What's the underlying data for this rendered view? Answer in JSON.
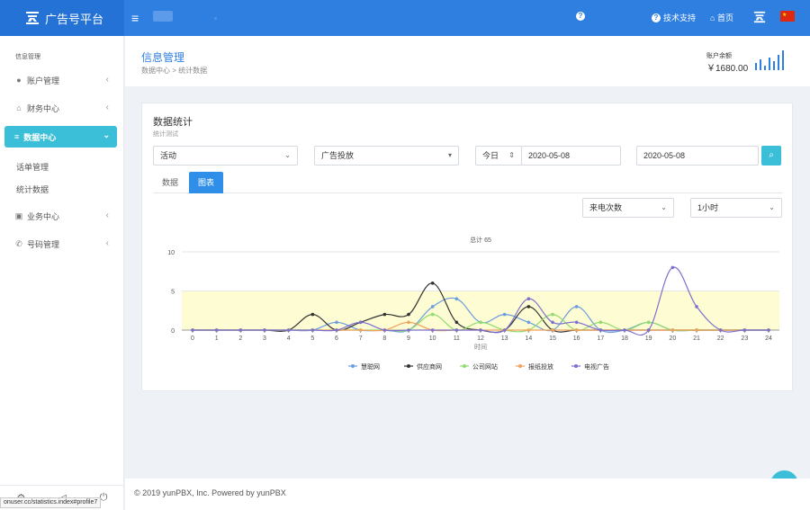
{
  "topbar": {
    "brand": "广告号平台",
    "support": "技术支持",
    "home": "首页"
  },
  "sidebar": {
    "section": "信息管理",
    "items": [
      {
        "label": "账户管理",
        "icon": "user-icon"
      },
      {
        "label": "财务中心",
        "icon": "bank-icon"
      },
      {
        "label": "数据中心",
        "icon": "database-icon"
      },
      {
        "label": "业务中心",
        "icon": "copy-icon"
      },
      {
        "label": "号码管理",
        "icon": "phone-icon"
      }
    ],
    "sub_items": [
      "话单管理",
      "统计数据"
    ]
  },
  "status_url": "onuser.cc/statistics.index#profile7",
  "header": {
    "title": "信息管理",
    "crumb_1": "数据中心",
    "crumb_sep": ">",
    "crumb_2": "统计数据",
    "balance_label": "账户余额",
    "balance_value": "￥1680.00"
  },
  "card": {
    "title": "数据统计",
    "subtitle": "统计测试",
    "filters": {
      "activity": "活动",
      "channel": "广告投放",
      "period": "今日",
      "start_date": "2020-05-08",
      "end_date": "2020-05-08",
      "metric": "来电次数",
      "granularity": "1小时"
    },
    "tabs": [
      "数据",
      "图表"
    ],
    "active_tab": 1
  },
  "footer": {
    "copyright": "© 2019 yunPBX, Inc. Powered by yunPBX"
  },
  "colors": {
    "primary": "#2f7fe0",
    "accent": "#3bbfd8"
  },
  "chart_data": {
    "type": "line",
    "title": "总计 65",
    "xlabel": "时间",
    "x": [
      0,
      1,
      2,
      3,
      4,
      5,
      6,
      7,
      8,
      9,
      10,
      11,
      12,
      13,
      14,
      15,
      16,
      17,
      18,
      19,
      20,
      21,
      22,
      23,
      24
    ],
    "ylim": [
      0,
      10
    ],
    "yticks": [
      0,
      5,
      10
    ],
    "band": [
      0,
      5
    ],
    "smooth": true,
    "legend_position": "bottom",
    "series": [
      {
        "name": "慧聪网",
        "color": "#6a9de0",
        "values": [
          0,
          0,
          0,
          0,
          0,
          0,
          1,
          0,
          0,
          0,
          3,
          4,
          1,
          2,
          1,
          0,
          3,
          0,
          0,
          1,
          0,
          0,
          0,
          0,
          0
        ]
      },
      {
        "name": "供应商网",
        "color": "#333333",
        "values": [
          0,
          0,
          0,
          0,
          0,
          2,
          0,
          1,
          2,
          2,
          6,
          1,
          0,
          0,
          3,
          0,
          0,
          0,
          0,
          0,
          0,
          0,
          0,
          0,
          0
        ]
      },
      {
        "name": "公司网站",
        "color": "#8fdc6e",
        "values": [
          0,
          0,
          0,
          0,
          0,
          0,
          0,
          0,
          0,
          0,
          2,
          0,
          1,
          0,
          0,
          2,
          0,
          1,
          0,
          1,
          0,
          0,
          0,
          0,
          0
        ]
      },
      {
        "name": "报纸投放",
        "color": "#f0a15a",
        "values": [
          0,
          0,
          0,
          0,
          0,
          0,
          0,
          0,
          0,
          1,
          0,
          0,
          0,
          0,
          0,
          0,
          0,
          0,
          0,
          0,
          0,
          0,
          0,
          0,
          0
        ]
      },
      {
        "name": "电视广告",
        "color": "#7c6fd0",
        "values": [
          0,
          0,
          0,
          0,
          0,
          0,
          0,
          1,
          0,
          0,
          0,
          0,
          0,
          0,
          4,
          1,
          1,
          0,
          0,
          0,
          8,
          3,
          0,
          0,
          0
        ]
      }
    ]
  }
}
